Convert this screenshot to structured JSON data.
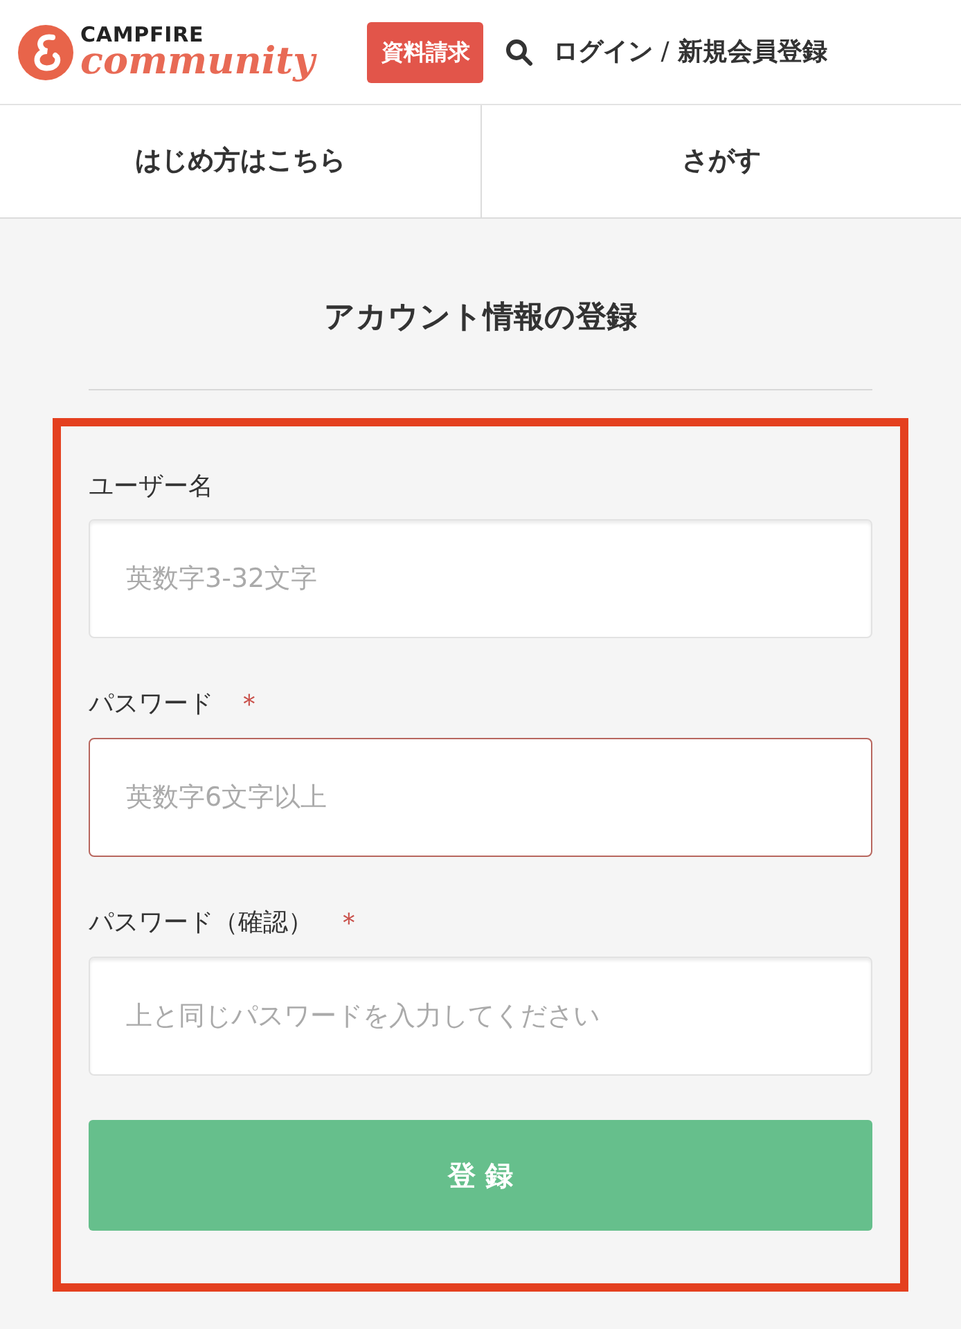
{
  "header": {
    "logo_top": "CAMPFIRE",
    "logo_bottom": "community",
    "request_button": "資料請求",
    "login_link": "ログイン",
    "separator": "/",
    "signup_link": "新規会員登録"
  },
  "nav_tabs": [
    {
      "label": "はじめ方はこちら"
    },
    {
      "label": "さがす"
    }
  ],
  "title": "アカウント情報の登録",
  "fields": [
    {
      "label": "ユーザー名",
      "placeholder": "英数字3-32文字",
      "required": false,
      "error": false
    },
    {
      "label": "パスワード",
      "placeholder": "英数字6文字以上",
      "required": true,
      "error": true
    },
    {
      "label": "パスワード（確認）",
      "placeholder": "上と同じパスワードを入力してください",
      "required": true,
      "error": false
    }
  ],
  "required_mark": "＊",
  "submit_button": "登 録"
}
